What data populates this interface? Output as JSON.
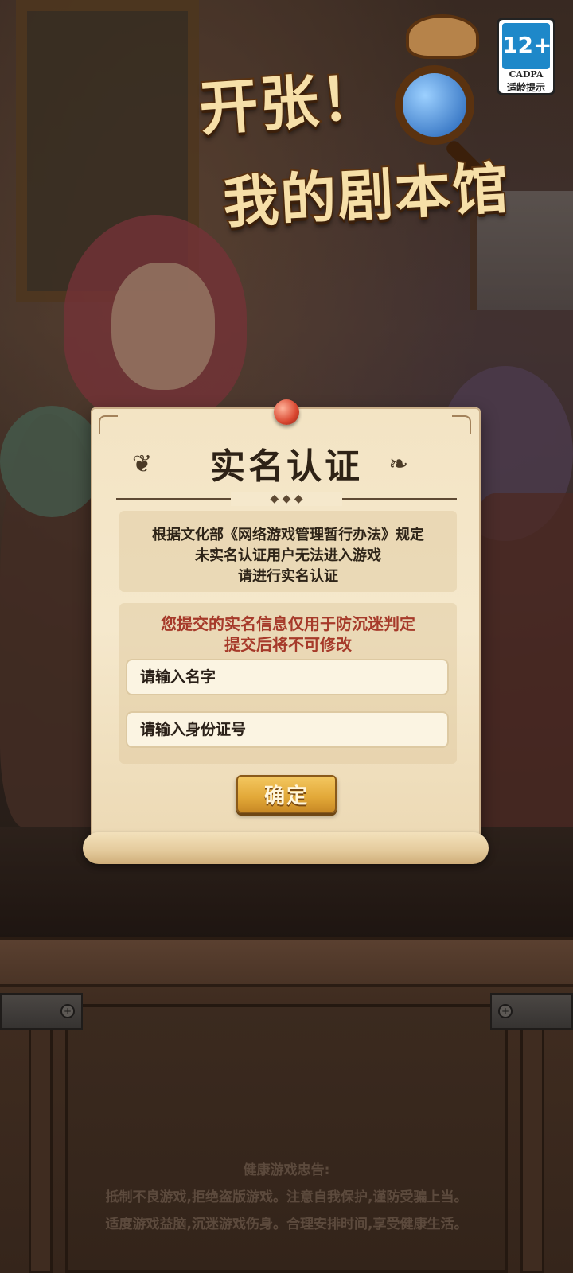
{
  "age_rating": {
    "rating": "12+",
    "org": "CADPA",
    "tip": "适龄提示"
  },
  "logo": {
    "line1": "开张！",
    "line2": "我的剧本馆"
  },
  "dialog": {
    "title": "实名认证",
    "notice_lines": [
      "根据文化部《网络游戏管理暂行办法》规定",
      "未实名认证用户无法进入游戏",
      "请进行实名认证"
    ],
    "warning_lines": [
      "您提交的实名信息仅用于防沉迷判定",
      "提交后将不可修改"
    ],
    "name_field": {
      "value": "",
      "placeholder": "请输入名字"
    },
    "id_field": {
      "value": "",
      "placeholder": "请输入身份证号"
    },
    "confirm_label": "确定"
  },
  "health_advice": {
    "title": "健康游戏忠告:",
    "lines": [
      "抵制不良游戏,拒绝盗版游戏。注意自我保护,谨防受骗上当。",
      "适度游戏益脑,沉迷游戏伤身。合理安排时间,享受健康生活。"
    ]
  },
  "colors": {
    "accent_button": "#e2a838",
    "warning_text": "#a63a2a",
    "parchment": "#f5e8cc"
  }
}
